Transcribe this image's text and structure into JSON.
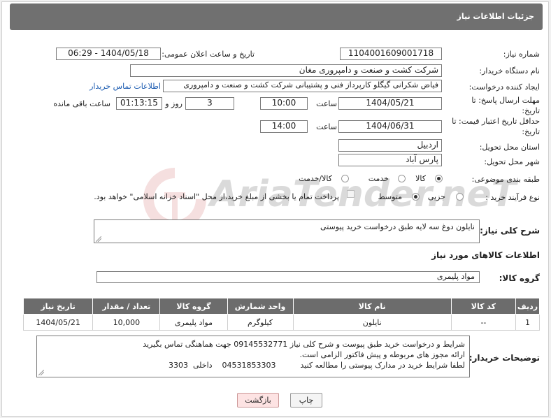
{
  "header": {
    "title": "جزئیات اطلاعات نیاز"
  },
  "fields": {
    "need_number": {
      "label": "شماره نیاز:",
      "value": "1104001609001718"
    },
    "announce": {
      "label": "تاریخ و ساعت اعلان عمومی:",
      "value": "1404/05/18 - 06:29"
    },
    "buyer_org": {
      "label": "نام دستگاه خریدار:",
      "value": "شرکت کشت و صنعت و دامپروری مغان"
    },
    "creator": {
      "label": "ایجاد کننده درخواست:",
      "value": "فیاض شکرانی گیگلو کارپرداز فنی و پشتیبانی شرکت کشت و صنعت و دامپروری",
      "contact_link": "اطلاعات تماس خریدار"
    },
    "deadline": {
      "label": "مهلت ارسال پاسخ: تا تاریخ:",
      "date": "1404/05/21",
      "time_label": "ساعت",
      "time": "10:00",
      "days": "3",
      "days_label": "روز و",
      "remaining": "01:13:15",
      "remaining_label": "ساعت باقی مانده"
    },
    "price_validity": {
      "label": "حداقل تاریخ اعتبار قیمت: تا تاریخ:",
      "date": "1404/06/31",
      "time_label": "ساعت",
      "time": "14:00"
    },
    "province": {
      "label": "استان محل تحویل:",
      "value": "اردبیل"
    },
    "city": {
      "label": "شهر محل تحویل:",
      "value": "پارس آباد"
    },
    "category": {
      "label": "طبقه بندی موضوعی:",
      "options": [
        "کالا",
        "خدمت",
        "کالا/خدمت"
      ],
      "selected": "کالا"
    },
    "process": {
      "label": "نوع فرآیند خرید :",
      "options": [
        "جزیی",
        "متوسط"
      ],
      "selected": "متوسط",
      "note": "پرداخت تمام یا بخشی از مبلغ خرید،از محل \"اسناد خزانه اسلامی\" خواهد بود."
    }
  },
  "description": {
    "label": "شرح کلی نیاز:",
    "value": "نایلون دوغ سه لایه طبق درخواست خرید پیوستی"
  },
  "goods_section": {
    "title": "اطلاعات کالاهای مورد نیاز",
    "group_label": "گروه کالا:",
    "group_value": "مواد پلیمری"
  },
  "table": {
    "headers": [
      "ردیف",
      "کد کالا",
      "نام کالا",
      "واحد شمارش",
      "گروه کالا",
      "تعداد / مقدار",
      "تاریخ نیاز"
    ],
    "rows": [
      [
        "1",
        "--",
        "نایلون",
        "کیلوگرم",
        "مواد پلیمری",
        "10,000",
        "1404/05/21"
      ]
    ]
  },
  "buyer_notes": {
    "label": "توضیحات خریدار:",
    "lines": [
      "شرایط و درخواست خرید طبق پیوست و شرح کلی نیاز 09145532771 جهت هماهنگی تماس بگیرید",
      "ارائه مجوز های مربوطه و پیش فاکتور الزامی است.",
      "لطفا شرایط خرید در مدارک پیوستی را مطالعه کنید          04531853303    داخلی  3303"
    ]
  },
  "buttons": {
    "print": "چاپ",
    "back": "بازگشت"
  },
  "watermark": {
    "text": "AriaTender.neT"
  },
  "colors": {
    "header_bg": "#707070",
    "table_header_bg": "#6c6c6c",
    "link": "#1a5ab0",
    "back_button_bg": "#fde3e3"
  }
}
